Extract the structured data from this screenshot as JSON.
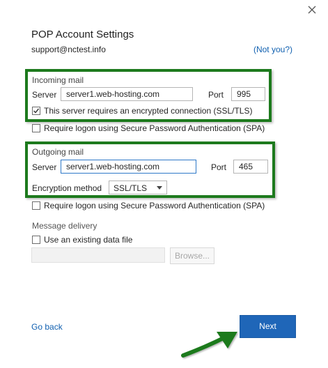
{
  "dialog": {
    "title": "POP Account Settings",
    "email": "support@nctest.info",
    "not_you_link": "(Not you?)"
  },
  "incoming": {
    "section_label": "Incoming mail",
    "server_label": "Server",
    "server_value": "server1.web-hosting.com",
    "port_label": "Port",
    "port_value": "995",
    "ssl_checkbox_label": "This server requires an encrypted connection (SSL/TLS)",
    "ssl_checked": true,
    "spa_checkbox_label": "Require logon using Secure Password Authentication (SPA)",
    "spa_checked": false
  },
  "outgoing": {
    "section_label": "Outgoing mail",
    "server_label": "Server",
    "server_value": "server1.web-hosting.com",
    "port_label": "Port",
    "port_value": "465",
    "encryption_label": "Encryption method",
    "encryption_value": "SSL/TLS",
    "spa_checkbox_label": "Require logon using Secure Password Authentication (SPA)",
    "spa_checked": false
  },
  "delivery": {
    "section_label": "Message delivery",
    "existing_file_label": "Use an existing data file",
    "existing_file_checked": false,
    "browse_label": "Browse..."
  },
  "footer": {
    "go_back_label": "Go back",
    "next_label": "Next"
  },
  "colors": {
    "accent": "#1f66b8",
    "link": "#1060b0",
    "highlight_box": "#1d7a1d"
  },
  "icons": {
    "close": "close-icon",
    "checkmark": "checkmark-icon",
    "dropdown": "chevron-down-icon",
    "pointer_arrow": "arrow-icon"
  }
}
